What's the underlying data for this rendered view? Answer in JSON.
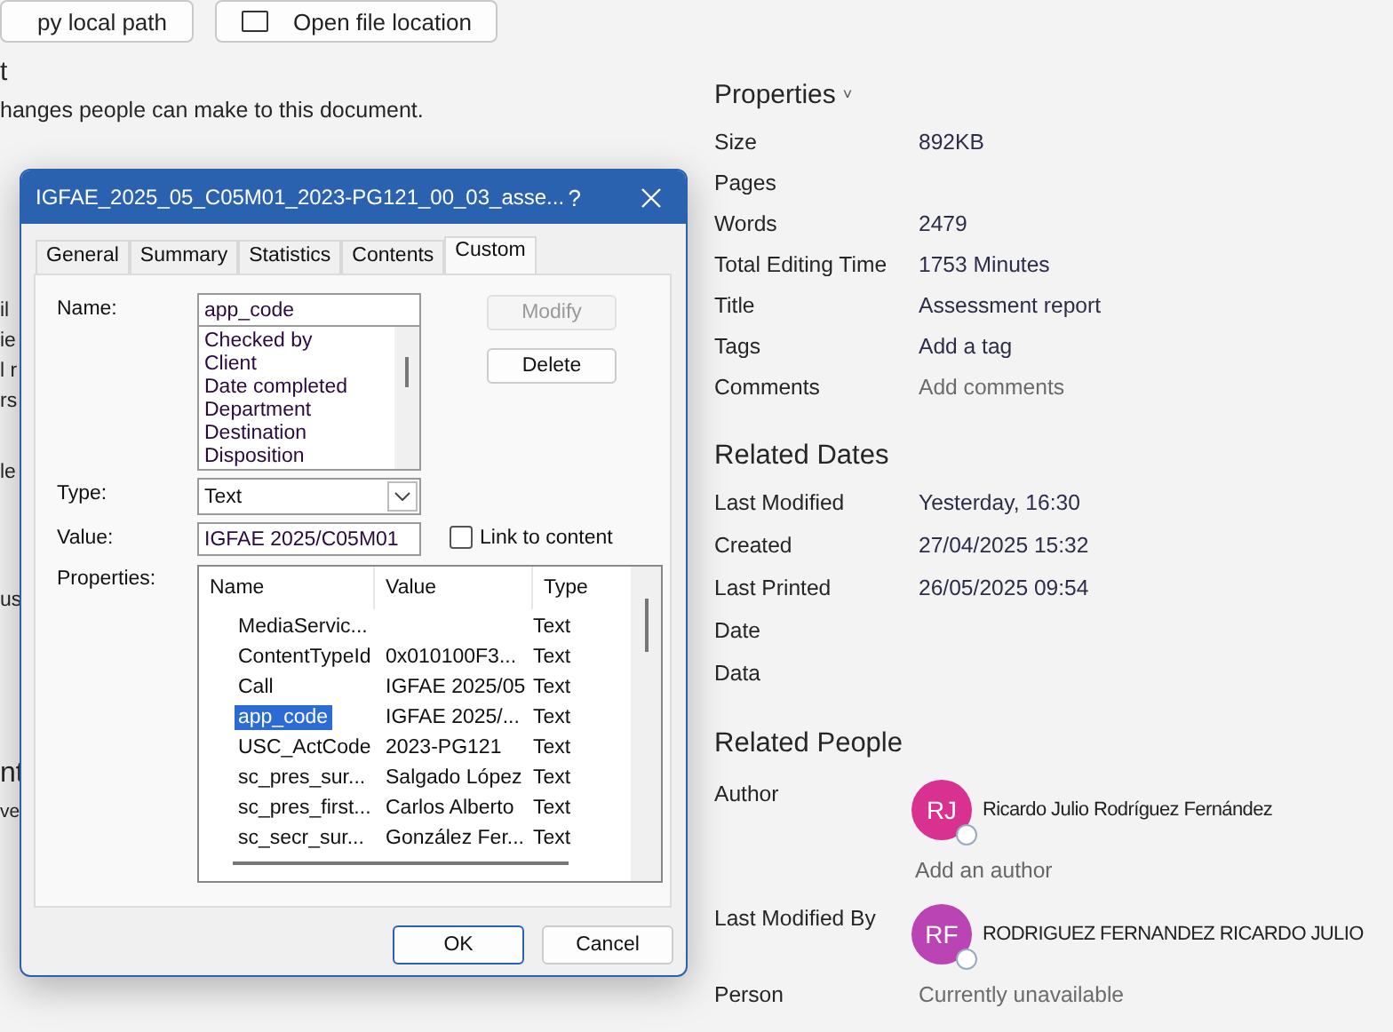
{
  "background": {
    "buttons": [
      {
        "label": "py local path",
        "icon": false
      },
      {
        "label": "Open file location",
        "icon": true
      }
    ],
    "heading": "t",
    "description": "hanges people can make to this document.",
    "fragments": [
      "il",
      "ie",
      "l r",
      "rs",
      "le",
      "us",
      "nt",
      "ve"
    ]
  },
  "properties": {
    "title": "Properties",
    "chevron": "˅",
    "rows": [
      {
        "label": "Size",
        "value": "892KB",
        "kind": "text"
      },
      {
        "label": "Pages",
        "kind": "text"
      },
      {
        "label": "Words",
        "value": "2479",
        "kind": "text"
      },
      {
        "label": "Total Editing Time",
        "value": "1753 Minutes",
        "kind": "text"
      },
      {
        "label": "Title",
        "value": "Assessment report",
        "kind": "text"
      },
      {
        "label": "Tags",
        "value": "Add a tag",
        "kind": "text"
      },
      {
        "label": "Comments",
        "value": "Add comments",
        "kind": "hint"
      }
    ]
  },
  "related_dates": {
    "title": "Related Dates",
    "rows": [
      {
        "label": "Last Modified",
        "value": "Yesterday, 16:30"
      },
      {
        "label": "Created",
        "value": "27/04/2025 15:32"
      },
      {
        "label": "Last Printed",
        "value": "26/05/2025 09:54"
      },
      {
        "label": "Date"
      },
      {
        "label": "Data"
      }
    ]
  },
  "related_people": {
    "title": "Related People",
    "people": [
      {
        "label": "Author",
        "initials": "RJ",
        "name": "Ricardo Julio Rodríguez Fernández",
        "color": "#d8318f",
        "add_link": "Add an author"
      },
      {
        "label": "Last Modified By",
        "initials": "RF",
        "name": "RODRIGUEZ FERNANDEZ RICARDO JULIO",
        "color": "#bb44b5"
      }
    ],
    "person": {
      "label": "Person",
      "value": "Currently unavailable"
    }
  },
  "dialog": {
    "title": "IGFAE_2025_05_C05M01_2023-PG121_00_03_asse...",
    "help": "?",
    "tabs": [
      {
        "label": "General",
        "selected": false
      },
      {
        "label": "Summary",
        "selected": false
      },
      {
        "label": "Statistics",
        "selected": false
      },
      {
        "label": "Contents",
        "selected": false
      },
      {
        "label": "Custom",
        "selected": true
      }
    ],
    "name_label": "Name:",
    "name_value": "app_code",
    "name_list": [
      "Checked by",
      "Client",
      "Date completed",
      "Department",
      "Destination",
      "Disposition"
    ],
    "modify": {
      "label": "Modify",
      "disabled": true
    },
    "delete": {
      "label": "Delete",
      "disabled": false
    },
    "type_label": "Type:",
    "type_value": "Text",
    "value_label": "Value:",
    "value_value": "IGFAE 2025/C05M01",
    "link_to_content": {
      "label": "Link to content",
      "checked": false
    },
    "properties_label": "Properties:",
    "columns": [
      "Name",
      "Value",
      "Type"
    ],
    "rows": [
      {
        "name": "MediaServic...",
        "type": "Text",
        "selected": false
      },
      {
        "name": "ContentTypeId",
        "value": "0x010100F3...",
        "type": "Text",
        "selected": false
      },
      {
        "name": "Call",
        "value": "IGFAE 2025/05",
        "type": "Text",
        "selected": false
      },
      {
        "name": "app_code",
        "value": "IGFAE 2025/...",
        "type": "Text",
        "selected": true
      },
      {
        "name": "USC_ActCode",
        "value": "2023-PG121",
        "type": "Text",
        "selected": false
      },
      {
        "name": "sc_pres_sur...",
        "value": "Salgado López",
        "type": "Text",
        "selected": false
      },
      {
        "name": "sc_pres_first...",
        "value": "Carlos Alberto",
        "type": "Text",
        "selected": false
      },
      {
        "name": "sc_secr_sur...",
        "value": "González Fer...",
        "type": "Text",
        "selected": false
      }
    ],
    "ok": "OK",
    "cancel": "Cancel"
  }
}
